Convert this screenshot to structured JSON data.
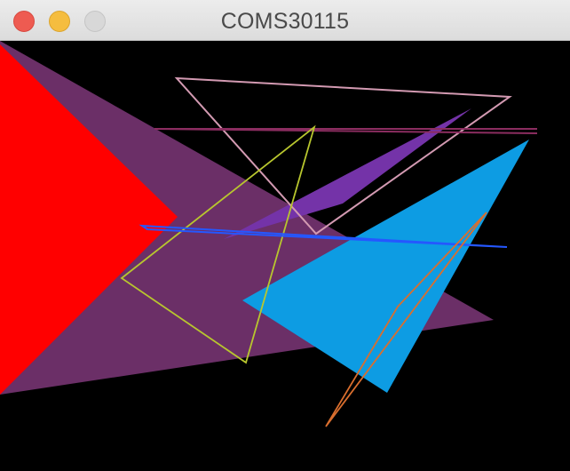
{
  "window": {
    "title": "COMS30115"
  },
  "controls": {
    "close": "close",
    "minimize": "minimize",
    "zoom": "zoom"
  },
  "scene": {
    "background": "#000000",
    "colors": {
      "red": "#ff0000",
      "purple": "#6b2f67",
      "violet": "#7433a8",
      "blue": "#0d9ce3",
      "pink": "#d39ab2",
      "maroon": "#8b2d60",
      "yellow_green": "#b8c62e",
      "royal_blue": "#2557ff",
      "orange": "#d96e2e"
    }
  }
}
